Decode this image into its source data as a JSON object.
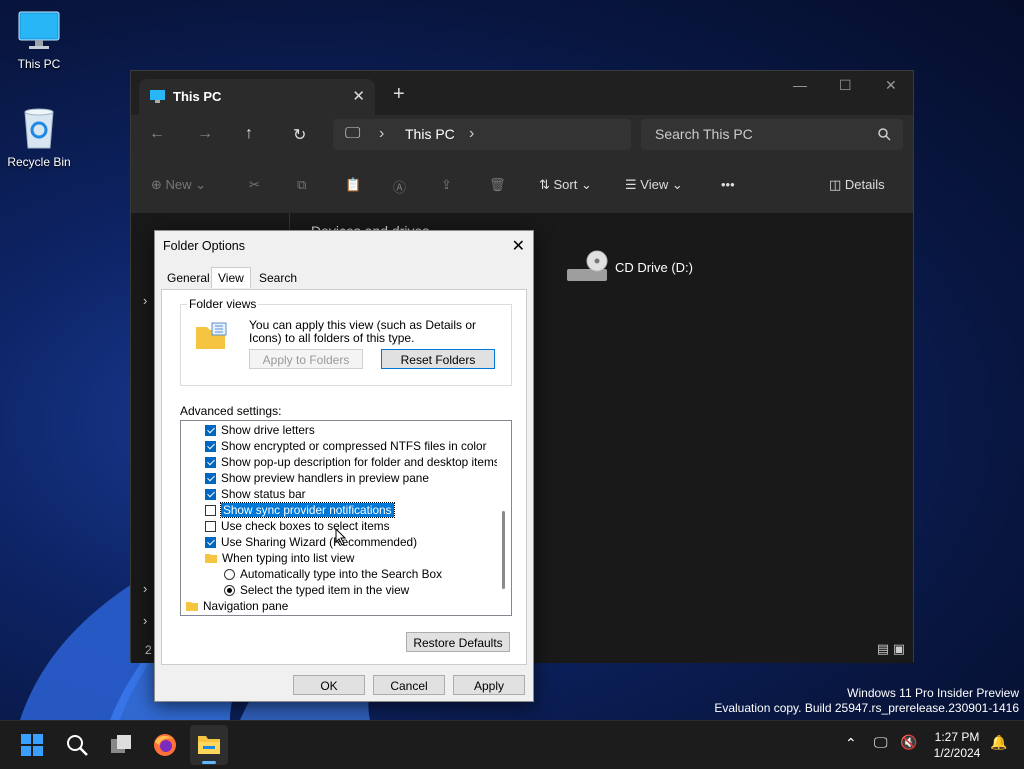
{
  "desktop": {
    "icons": [
      {
        "label": "This PC"
      },
      {
        "label": "Recycle Bin"
      }
    ]
  },
  "explorer": {
    "tab_title": "This PC",
    "address_segment": "This PC",
    "search_placeholder": "Search This PC",
    "commands": {
      "new": "New",
      "sort": "Sort",
      "view": "View",
      "more": "•••",
      "details": "Details"
    },
    "section_heading": "Devices and drives",
    "drive_label": "CD Drive (D:)",
    "status_count": "2"
  },
  "dialog": {
    "title": "Folder Options",
    "tabs": [
      "General",
      "View",
      "Search"
    ],
    "active_tab": "View",
    "folder_views": {
      "caption": "Folder views",
      "description": "You can apply this view (such as Details or Icons) to all folders of this type.",
      "apply_button": "Apply to Folders",
      "reset_button": "Reset Folders"
    },
    "advanced_label": "Advanced settings:",
    "advanced_items": [
      {
        "label": "Show drive letters",
        "kind": "checkbox",
        "checked": true
      },
      {
        "label": "Show encrypted or compressed NTFS files in color",
        "kind": "checkbox",
        "checked": true
      },
      {
        "label": "Show pop-up description for folder and desktop items",
        "kind": "checkbox",
        "checked": true
      },
      {
        "label": "Show preview handlers in preview pane",
        "kind": "checkbox",
        "checked": true
      },
      {
        "label": "Show status bar",
        "kind": "checkbox",
        "checked": true
      },
      {
        "label": "Show sync provider notifications",
        "kind": "checkbox",
        "checked": false,
        "selected": true
      },
      {
        "label": "Use check boxes to select items",
        "kind": "checkbox",
        "checked": false
      },
      {
        "label": "Use Sharing Wizard (Recommended)",
        "kind": "checkbox",
        "checked": true
      },
      {
        "label": "When typing into list view",
        "kind": "folder"
      },
      {
        "label": "Automatically type into the Search Box",
        "kind": "radio",
        "checked": false
      },
      {
        "label": "Select the typed item in the view",
        "kind": "radio",
        "checked": true
      },
      {
        "label": "Navigation pane",
        "kind": "folder"
      }
    ],
    "restore_button": "Restore Defaults",
    "ok_button": "OK",
    "cancel_button": "Cancel",
    "apply_button": "Apply"
  },
  "watermark": {
    "line1": "Windows 11 Pro Insider Preview",
    "line2": "Evaluation copy. Build 25947.rs_prerelease.230901-1416"
  },
  "taskbar": {
    "time": "1:27 PM",
    "date": "1/2/2024",
    "icons": [
      "start-icon",
      "search-icon",
      "task-view-icon",
      "firefox-icon",
      "file-explorer-icon"
    ]
  },
  "colors": {
    "accent": "#0078d7",
    "checkbox": "#0067c0",
    "explorer_bg": "#202020",
    "taskbar_bg": "#1c1c1c"
  }
}
